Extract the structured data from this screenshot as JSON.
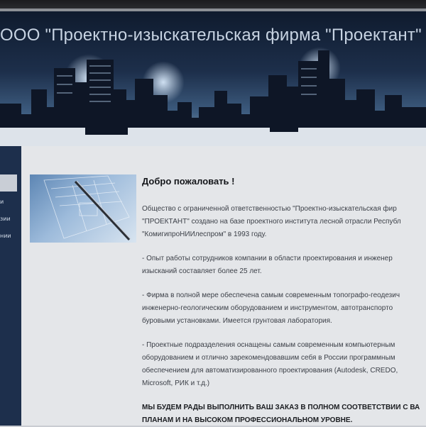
{
  "header": {
    "site_title": "ООО \"Проектно-изыскательская фирма \"Проектант\""
  },
  "sidebar": {
    "items": [
      {
        "label": "и"
      },
      {
        "label": "зии"
      },
      {
        "label": "нии"
      }
    ]
  },
  "main": {
    "welcome": "Добро пожаловать !",
    "paragraphs": [
      [
        "Общество с ограниченной ответственностью \"Проектно-изыскательская фир",
        "\"ПРОЕКТАНТ\" создано на базе проектного института лесной отрасли Республ",
        "\"КомигипроНИИлеспром\" в 1993 году."
      ],
      [
        "- Опыт работы сотрудников компании в области проектирования и инженер",
        "изысканий составляет более 25 лет."
      ],
      [
        "- Фирма в полной мере обеспечена самым современным топографо-геодезич",
        "инженерно-геологическим оборудованием и инструментом, автотранспорто",
        "буровыми установками. Имеется грунтовая лаборатория."
      ],
      [
        "- Проектные подразделения оснащены самым современным компьютерным",
        "оборудованием и отлично зарекомендовавшим себя в России программным",
        "обеспечением для автоматизированного проектирования (Autodesk, CREDO,",
        "Microsoft, РИК и т.д.)"
      ]
    ],
    "closing": [
      "МЫ БУДЕМ РАДЫ ВЫПОЛНИТЬ ВАШ ЗАКАЗ В ПОЛНОМ СООТВЕТСТВИИ С ВА",
      "ПЛАНАМ И НА ВЫСОКОМ ПРОФЕССИОНАЛЬНОМ УРОВНЕ."
    ]
  },
  "colors": {
    "sidebar_bg": "#1d2f4c",
    "content_bg": "#e4e6e9",
    "header_dark": "#0f1b2e"
  }
}
